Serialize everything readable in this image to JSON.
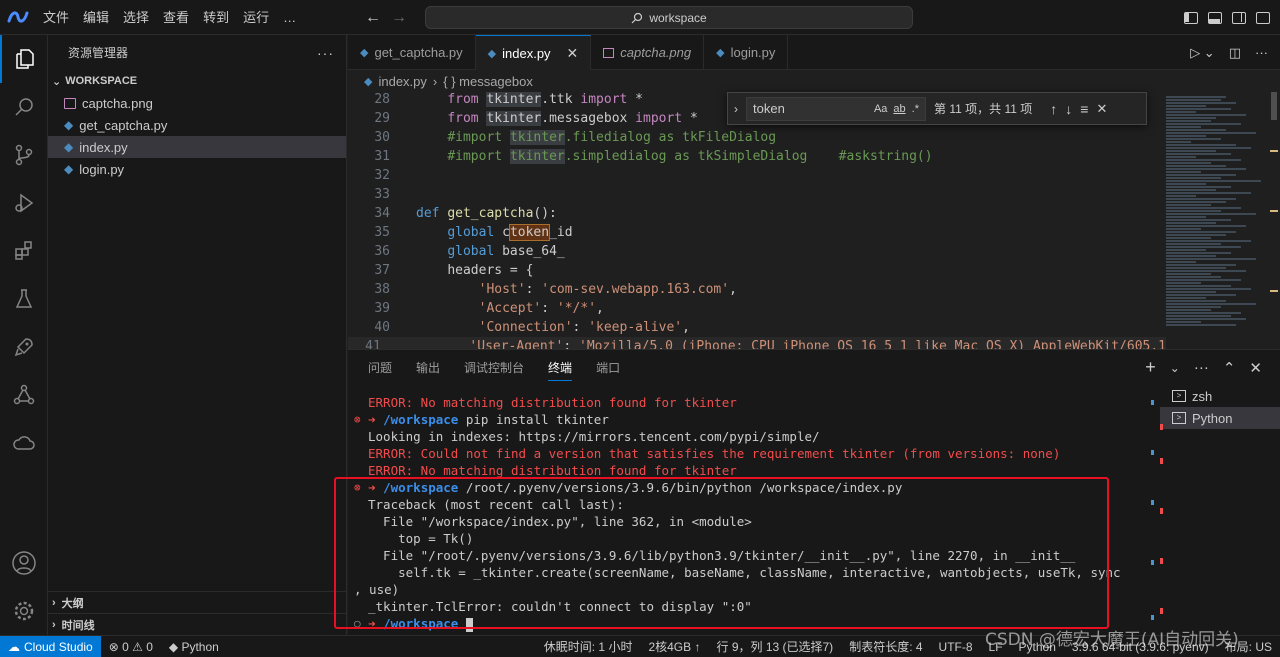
{
  "menu": [
    "文件",
    "编辑",
    "选择",
    "查看",
    "转到",
    "运行",
    "…"
  ],
  "command_center": {
    "label": "workspace"
  },
  "sidebar": {
    "title": "资源管理器",
    "workspace_label": "WORKSPACE",
    "files": [
      {
        "name": "captcha.png",
        "icon": "image-file-icon",
        "selected": false
      },
      {
        "name": "get_captcha.py",
        "icon": "python-file-icon",
        "selected": false
      },
      {
        "name": "index.py",
        "icon": "python-file-icon",
        "selected": true
      },
      {
        "name": "login.py",
        "icon": "python-file-icon",
        "selected": false
      }
    ],
    "outline_label": "大纲",
    "timeline_label": "时间线"
  },
  "tabs": [
    {
      "label": "get_captcha.py",
      "active": false
    },
    {
      "label": "index.py",
      "active": true
    },
    {
      "label": "captcha.png",
      "active": false
    },
    {
      "label": "login.py",
      "active": false
    }
  ],
  "breadcrumb": {
    "file": "index.py",
    "symbol": "{ } messagebox"
  },
  "find": {
    "value": "token",
    "opt_case": "Aa",
    "opt_word": "ab",
    "opt_regex": ".*",
    "result": "第 11 项，共 11 项"
  },
  "editor": {
    "lines": [
      {
        "n": "28"
      },
      {
        "n": "29"
      },
      {
        "n": "30"
      },
      {
        "n": "31"
      },
      {
        "n": "32"
      },
      {
        "n": "33"
      },
      {
        "n": "34"
      },
      {
        "n": "35"
      },
      {
        "n": "36"
      },
      {
        "n": "37"
      },
      {
        "n": "38"
      },
      {
        "n": "39"
      },
      {
        "n": "40"
      },
      {
        "n": "41"
      }
    ],
    "code": {
      "l28": [
        "from ",
        "tkinter",
        ".ttk ",
        "import",
        " *"
      ],
      "l29": [
        "from ",
        "tkinter",
        ".messagebox ",
        "import",
        " *"
      ],
      "l30": [
        "#import ",
        "tkinter",
        ".filedialog as tkFileDialog"
      ],
      "l31": [
        "#import ",
        "tkinter",
        ".simpledialog as tkSimpleDialog    #askstring()"
      ],
      "l34": [
        "def ",
        "get_captcha",
        "():"
      ],
      "l35": [
        "global ",
        "c",
        "token",
        "_id"
      ],
      "l36": [
        "global ",
        "base_64_"
      ],
      "l37": [
        "headers = {"
      ],
      "l38": [
        "'Host'",
        ": ",
        "'com-sev.webapp.163.com'",
        ","
      ],
      "l39": [
        "'Accept'",
        ": ",
        "'*/*'",
        ","
      ],
      "l40": [
        "'Connection'",
        ": ",
        "'keep-alive'",
        ","
      ],
      "l41": [
        "'User-Agent'",
        ": ",
        "'Mozilla/5.0 (iPhone; CPU iPhone OS 16_5_1 like Mac OS X) AppleWebKit/605.1"
      ]
    }
  },
  "panel": {
    "tabs": [
      "问题",
      "输出",
      "调试控制台",
      "终端",
      "端口"
    ],
    "active_tab": "终端",
    "terminals": [
      "zsh",
      "Python"
    ],
    "terminal": {
      "t1": "ERROR: No matching distribution found for tkinter",
      "t2_path": "/workspace",
      "t2_cmd": " pip install tkinter",
      "t3": "Looking in indexes: https://mirrors.tencent.com/pypi/simple/",
      "t4": "ERROR: Could not find a version that satisfies the requirement tkinter (from versions: none)",
      "t5": "ERROR: No matching distribution found for tkinter",
      "t6_path": "/workspace",
      "t6_cmd": " /root/.pyenv/versions/3.9.6/bin/python /workspace/index.py",
      "t7": "Traceback (most recent call last):",
      "t8": "  File \"/workspace/index.py\", line 362, in <module>",
      "t9": "    top = Tk()",
      "t10": "  File \"/root/.pyenv/versions/3.9.6/lib/python3.9/tkinter/__init__.py\", line 2270, in __init__",
      "t11": "    self.tk = _tkinter.create(screenName, baseName, className, interactive, wantobjects, useTk, sync",
      "t12": ", use)",
      "t13": "_tkinter.TclError: couldn't connect to display \":0\"",
      "t14_path": "/workspace",
      "arrow": "➜",
      "err_mark": "⊗",
      "ok_mark": "○"
    }
  },
  "statusbar": {
    "remote": "Cloud Studio",
    "problems": "⊗ 0 ⚠ 0",
    "language_status": "Python",
    "sleep": "休眠时间: 1 小时",
    "machine": "2核4GB ↑",
    "cursor": "行 9，列 13 (已选择7)",
    "tabsize": "制表符长度: 4",
    "encoding": "UTF-8",
    "eol": "LF",
    "language": "Python",
    "interpreter": "3.9.6 64-bit (3.9.6: pyenv)",
    "layout": "布局: US"
  },
  "watermark": "CSDN @德宏大魔王(AI自动回关)",
  "colors": {
    "accent": "#0078d4",
    "error": "#f14c4c",
    "annotation_box": "#e81123"
  }
}
